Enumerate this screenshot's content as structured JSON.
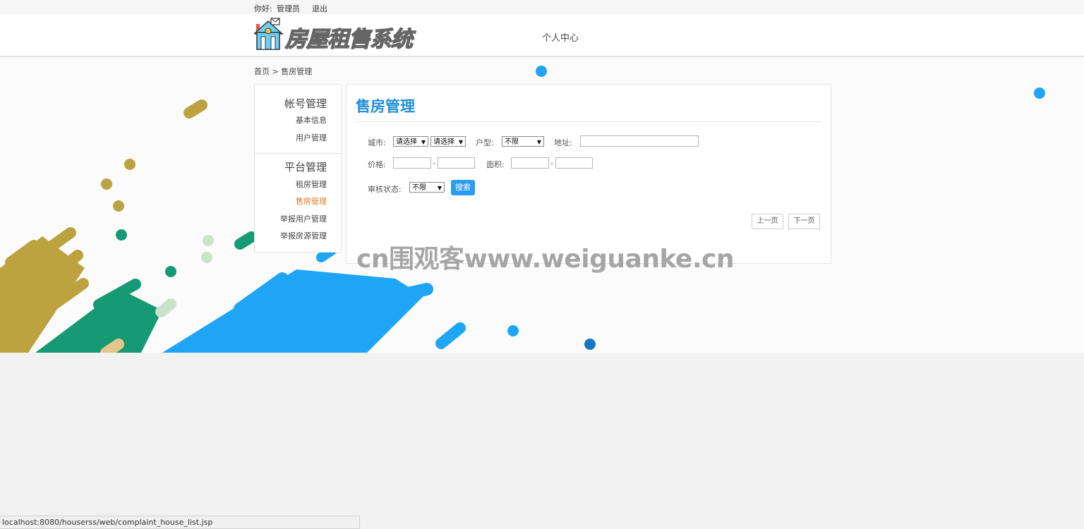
{
  "topbar": {
    "greeting": "你好:",
    "username": "管理员",
    "logout": "退出"
  },
  "header": {
    "logo_text": "房屋租售系统",
    "nav_personal": "个人中心"
  },
  "breadcrumb": {
    "home": "首页",
    "separator": ">",
    "current": "售房管理"
  },
  "sidebar": {
    "groups": [
      {
        "title": "帐号管理",
        "items": [
          {
            "label": "基本信息"
          },
          {
            "label": "用户管理"
          }
        ]
      },
      {
        "title": "平台管理",
        "items": [
          {
            "label": "租房管理"
          },
          {
            "label": "售房管理",
            "active": true
          },
          {
            "label": "举报用户管理"
          },
          {
            "label": "举报房源管理"
          }
        ]
      }
    ]
  },
  "main": {
    "title": "售房管理",
    "filters": {
      "city_label": "城市:",
      "city_province_value": "请选择",
      "city_city_value": "请选择",
      "type_label": "户型:",
      "type_value": "不限",
      "address_label": "地址:",
      "price_label": "价格:",
      "area_label": "面积:",
      "range_sep": "-",
      "status_label": "审核状态:",
      "status_value": "不限",
      "search_button": "搜索"
    },
    "pager": {
      "prev": "上一页",
      "next": "下一页"
    }
  },
  "watermark": "cn围观客www.weiguanke.cn",
  "statusbar": {
    "url": "localhost:8080/houserss/web/complaint_house_list.jsp"
  },
  "colors": {
    "accent_blue": "#1f8fd6",
    "button_blue": "#2b9cf2",
    "active_orange": "#e87722",
    "deco_gold": "#bca33f",
    "deco_green": "#159a73",
    "deco_blue": "#1fa5f5"
  }
}
